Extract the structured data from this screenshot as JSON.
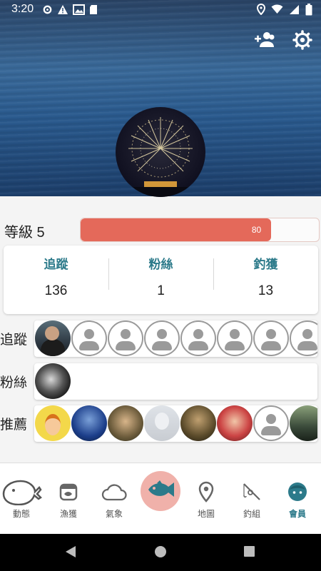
{
  "status_bar": {
    "time": "3:20",
    "left_icons": [
      "settings-icon",
      "warning-icon",
      "image-icon",
      "sd-card-icon"
    ],
    "right_icons": [
      "location-icon",
      "wifi-icon",
      "signal-icon",
      "battery-icon"
    ]
  },
  "header": {
    "actions": [
      "add-friend-icon",
      "settings-icon"
    ],
    "profile_photo": "fireworks-avatar"
  },
  "level": {
    "label": "等級 5",
    "progress": 80,
    "progress_text": "80",
    "bar_color": "#e4695a"
  },
  "stats": [
    {
      "label": "追蹤",
      "value": "136"
    },
    {
      "label": "粉絲",
      "value": "1"
    },
    {
      "label": "釣獲",
      "value": "13"
    }
  ],
  "rows": [
    {
      "label": "追蹤",
      "avatars": [
        "photo1",
        "placeholder",
        "placeholder",
        "placeholder",
        "placeholder",
        "placeholder",
        "placeholder",
        "placeholder"
      ]
    },
    {
      "label": "粉絲",
      "avatars": [
        "photo-bw"
      ]
    },
    {
      "label": "推薦",
      "avatars": [
        "cartoon",
        "photo-blue",
        "photo-warm",
        "photo-gray",
        "photo-man",
        "photo-red",
        "placeholder",
        "photo-green"
      ]
    }
  ],
  "bottom_nav": [
    {
      "label": "動態",
      "icon": "whale-icon"
    },
    {
      "label": "漁獲",
      "icon": "fish-bowl-icon"
    },
    {
      "label": "氣象",
      "icon": "cloud-icon"
    },
    {
      "label": "",
      "icon": "fish-icon"
    },
    {
      "label": "地圖",
      "icon": "map-pin-icon"
    },
    {
      "label": "釣組",
      "icon": "fishing-rod-icon"
    },
    {
      "label": "會員",
      "icon": "member-face-icon",
      "active": true
    }
  ],
  "colors": {
    "accent": "#2c7a8a",
    "fab": "#f0b1aa",
    "fab_icon": "#2c7a8a"
  }
}
